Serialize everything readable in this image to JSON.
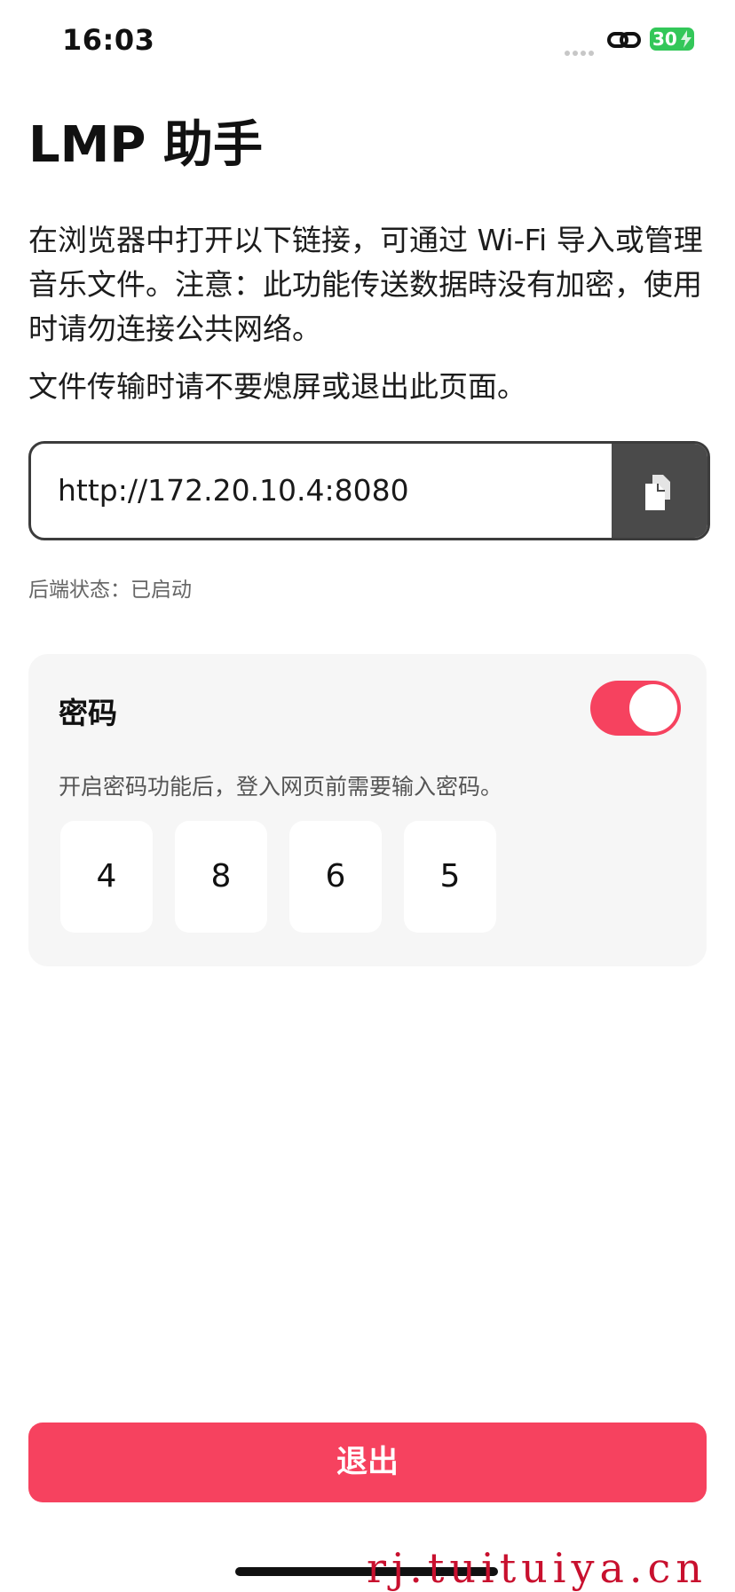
{
  "status_bar": {
    "time": "16:03",
    "battery_level": "30",
    "icons": [
      "signal-dots-icon",
      "link-icon",
      "battery-charging-icon"
    ]
  },
  "page": {
    "title": "LMP 助手",
    "description": "在浏览器中打开以下链接，可通过 Wi-Fi 导入或管理音乐文件。注意：此功能传送数据時没有加密，使用时请勿连接公共网络。",
    "warning": "文件传输时请不要熄屏或退出此页面。"
  },
  "server": {
    "url": "http://172.20.10.4:8080",
    "copy_icon": "copy-icon",
    "backend_status": "后端状态：已启动"
  },
  "password": {
    "title": "密码",
    "enabled": true,
    "hint": "开启密码功能后，登入网页前需要输入密码。",
    "digits": [
      "4",
      "8",
      "6",
      "5"
    ]
  },
  "actions": {
    "exit_label": "退出"
  },
  "watermark": "rj.tuituiya.cn",
  "colors": {
    "accent": "#f6425f",
    "copy_button_bg": "#4a4a4a",
    "card_bg": "#f6f6f6",
    "battery": "#33c759",
    "watermark": "#c8102e"
  }
}
